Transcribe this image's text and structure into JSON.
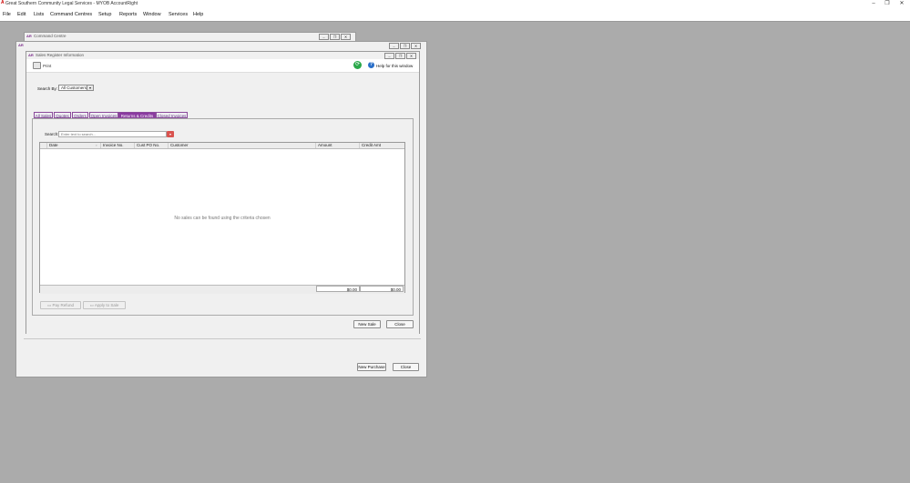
{
  "app": {
    "title": "Great Southern Community Legal Services - MYOB AccountRight",
    "logo": "A"
  },
  "window_controls": {
    "minimize": "–",
    "restore": "❐",
    "close": "✕"
  },
  "menu": [
    {
      "label": "File"
    },
    {
      "label": "Edit"
    },
    {
      "label": "Lists"
    },
    {
      "label": "Command Centres"
    },
    {
      "label": "Setup"
    },
    {
      "label": "Reports"
    },
    {
      "label": "Window"
    },
    {
      "label": "Services"
    },
    {
      "label": "Help"
    }
  ],
  "command_centre": {
    "title": "Command Centre",
    "badge": "AR"
  },
  "purchases_window": {
    "badge": "AR",
    "new_purchase_label": "New Purchase",
    "close_label": "Close"
  },
  "sales_window": {
    "title": "Sales Register Information",
    "badge": "AR",
    "print_label": "Print",
    "help_label": "Help for this window",
    "search_by_label": "Search By:",
    "search_by_value": "All Customers",
    "tabs": [
      {
        "label": "All Sales"
      },
      {
        "label": "Quotes"
      },
      {
        "label": "Orders"
      },
      {
        "label": "Open Invoices"
      },
      {
        "label": "Returns & Credits"
      },
      {
        "label": "Closed Invoices"
      }
    ],
    "active_tab": "Returns & Credits",
    "search_label": "Search:",
    "search_placeholder": "Enter text to search...",
    "columns": [
      {
        "label": "Date"
      },
      {
        "label": "Invoice No."
      },
      {
        "label": "Cust PO No."
      },
      {
        "label": "Customer"
      },
      {
        "label": "Amount"
      },
      {
        "label": "Credit Amt"
      }
    ],
    "empty_message": "No sales can be found using the criteria chosen",
    "totals": {
      "amount": "$0.00",
      "credit": "$0.00"
    },
    "pay_refund_label": "Pay Refund",
    "apply_to_sale_label": "Apply to Sale",
    "new_sale_label": "New Sale",
    "close_label": "Close"
  },
  "colors": {
    "accent": "#8a3aa0",
    "desktop": "#ababab"
  }
}
